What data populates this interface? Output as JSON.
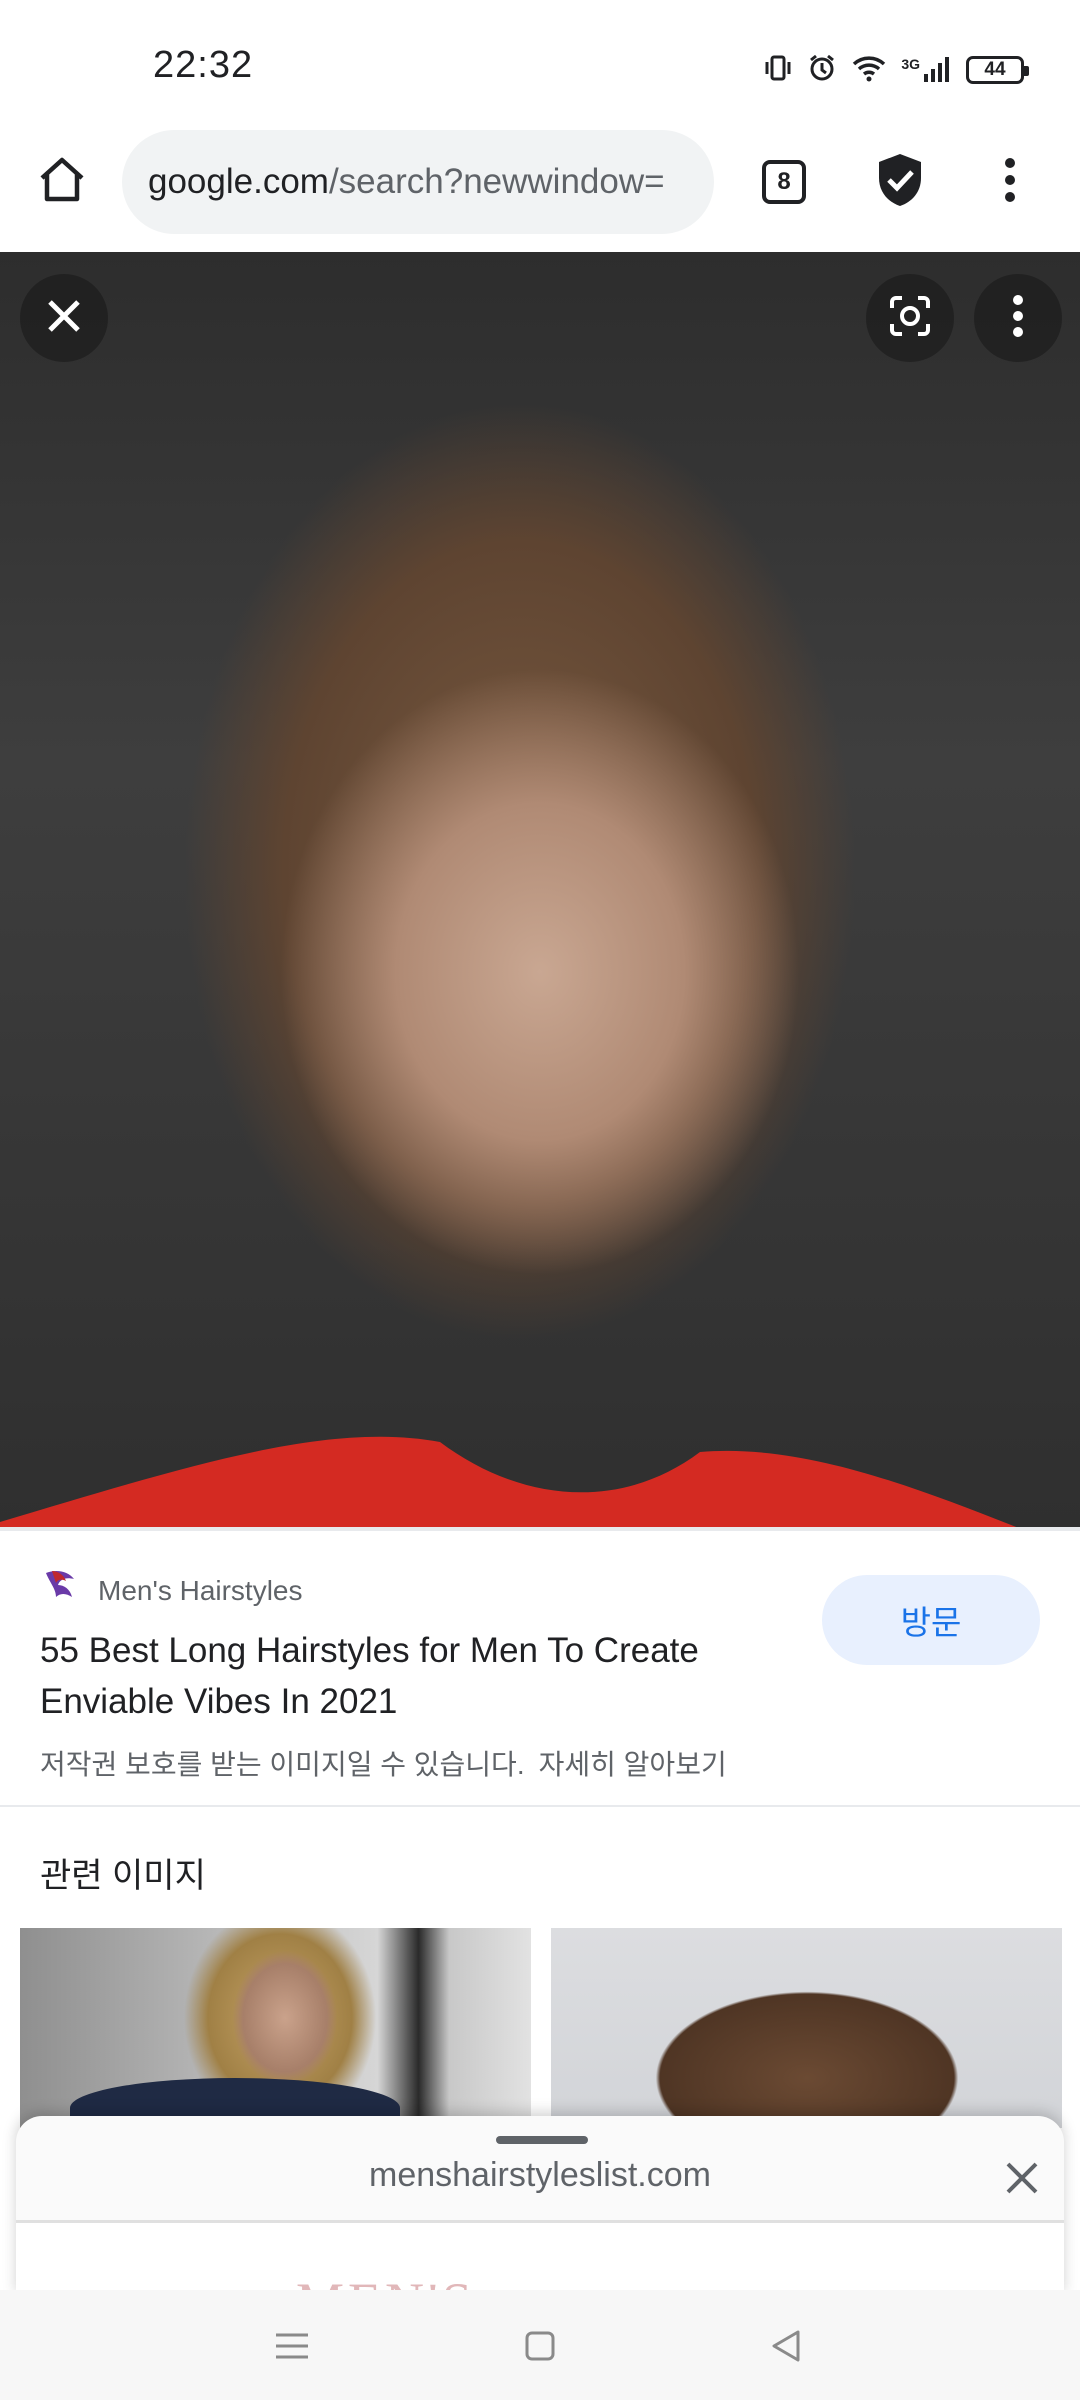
{
  "status_bar": {
    "time": "22:32",
    "network": "3G",
    "battery": "44"
  },
  "browser": {
    "url_domain": "google.com",
    "url_path": "/search?newwindow=",
    "tab_count": "8",
    "icons": [
      "home-icon",
      "shield-check-icon",
      "more-vert-icon"
    ]
  },
  "image_viewer": {
    "close_icon": "close-icon",
    "lens_icon": "google-lens-icon",
    "more_icon": "more-vert-icon"
  },
  "result": {
    "site_name": "Men's Hairstyles",
    "title": "55 Best Long Hairstyles for Men To Create Enviable Vibes In 2021",
    "visit_label": "방문",
    "copyright_notice": "저작권 보호를 받는 이미지일 수 있습니다.",
    "learn_more": "자세히 알아보기"
  },
  "related": {
    "heading": "관련 이미지"
  },
  "bottom_sheet": {
    "url": "menshairstyleslist.com",
    "logo_text": "MEN'S"
  },
  "colors": {
    "accent": "#1a73e8",
    "visit_bg": "#e8f0fe",
    "shirt_red": "#d42a22"
  }
}
